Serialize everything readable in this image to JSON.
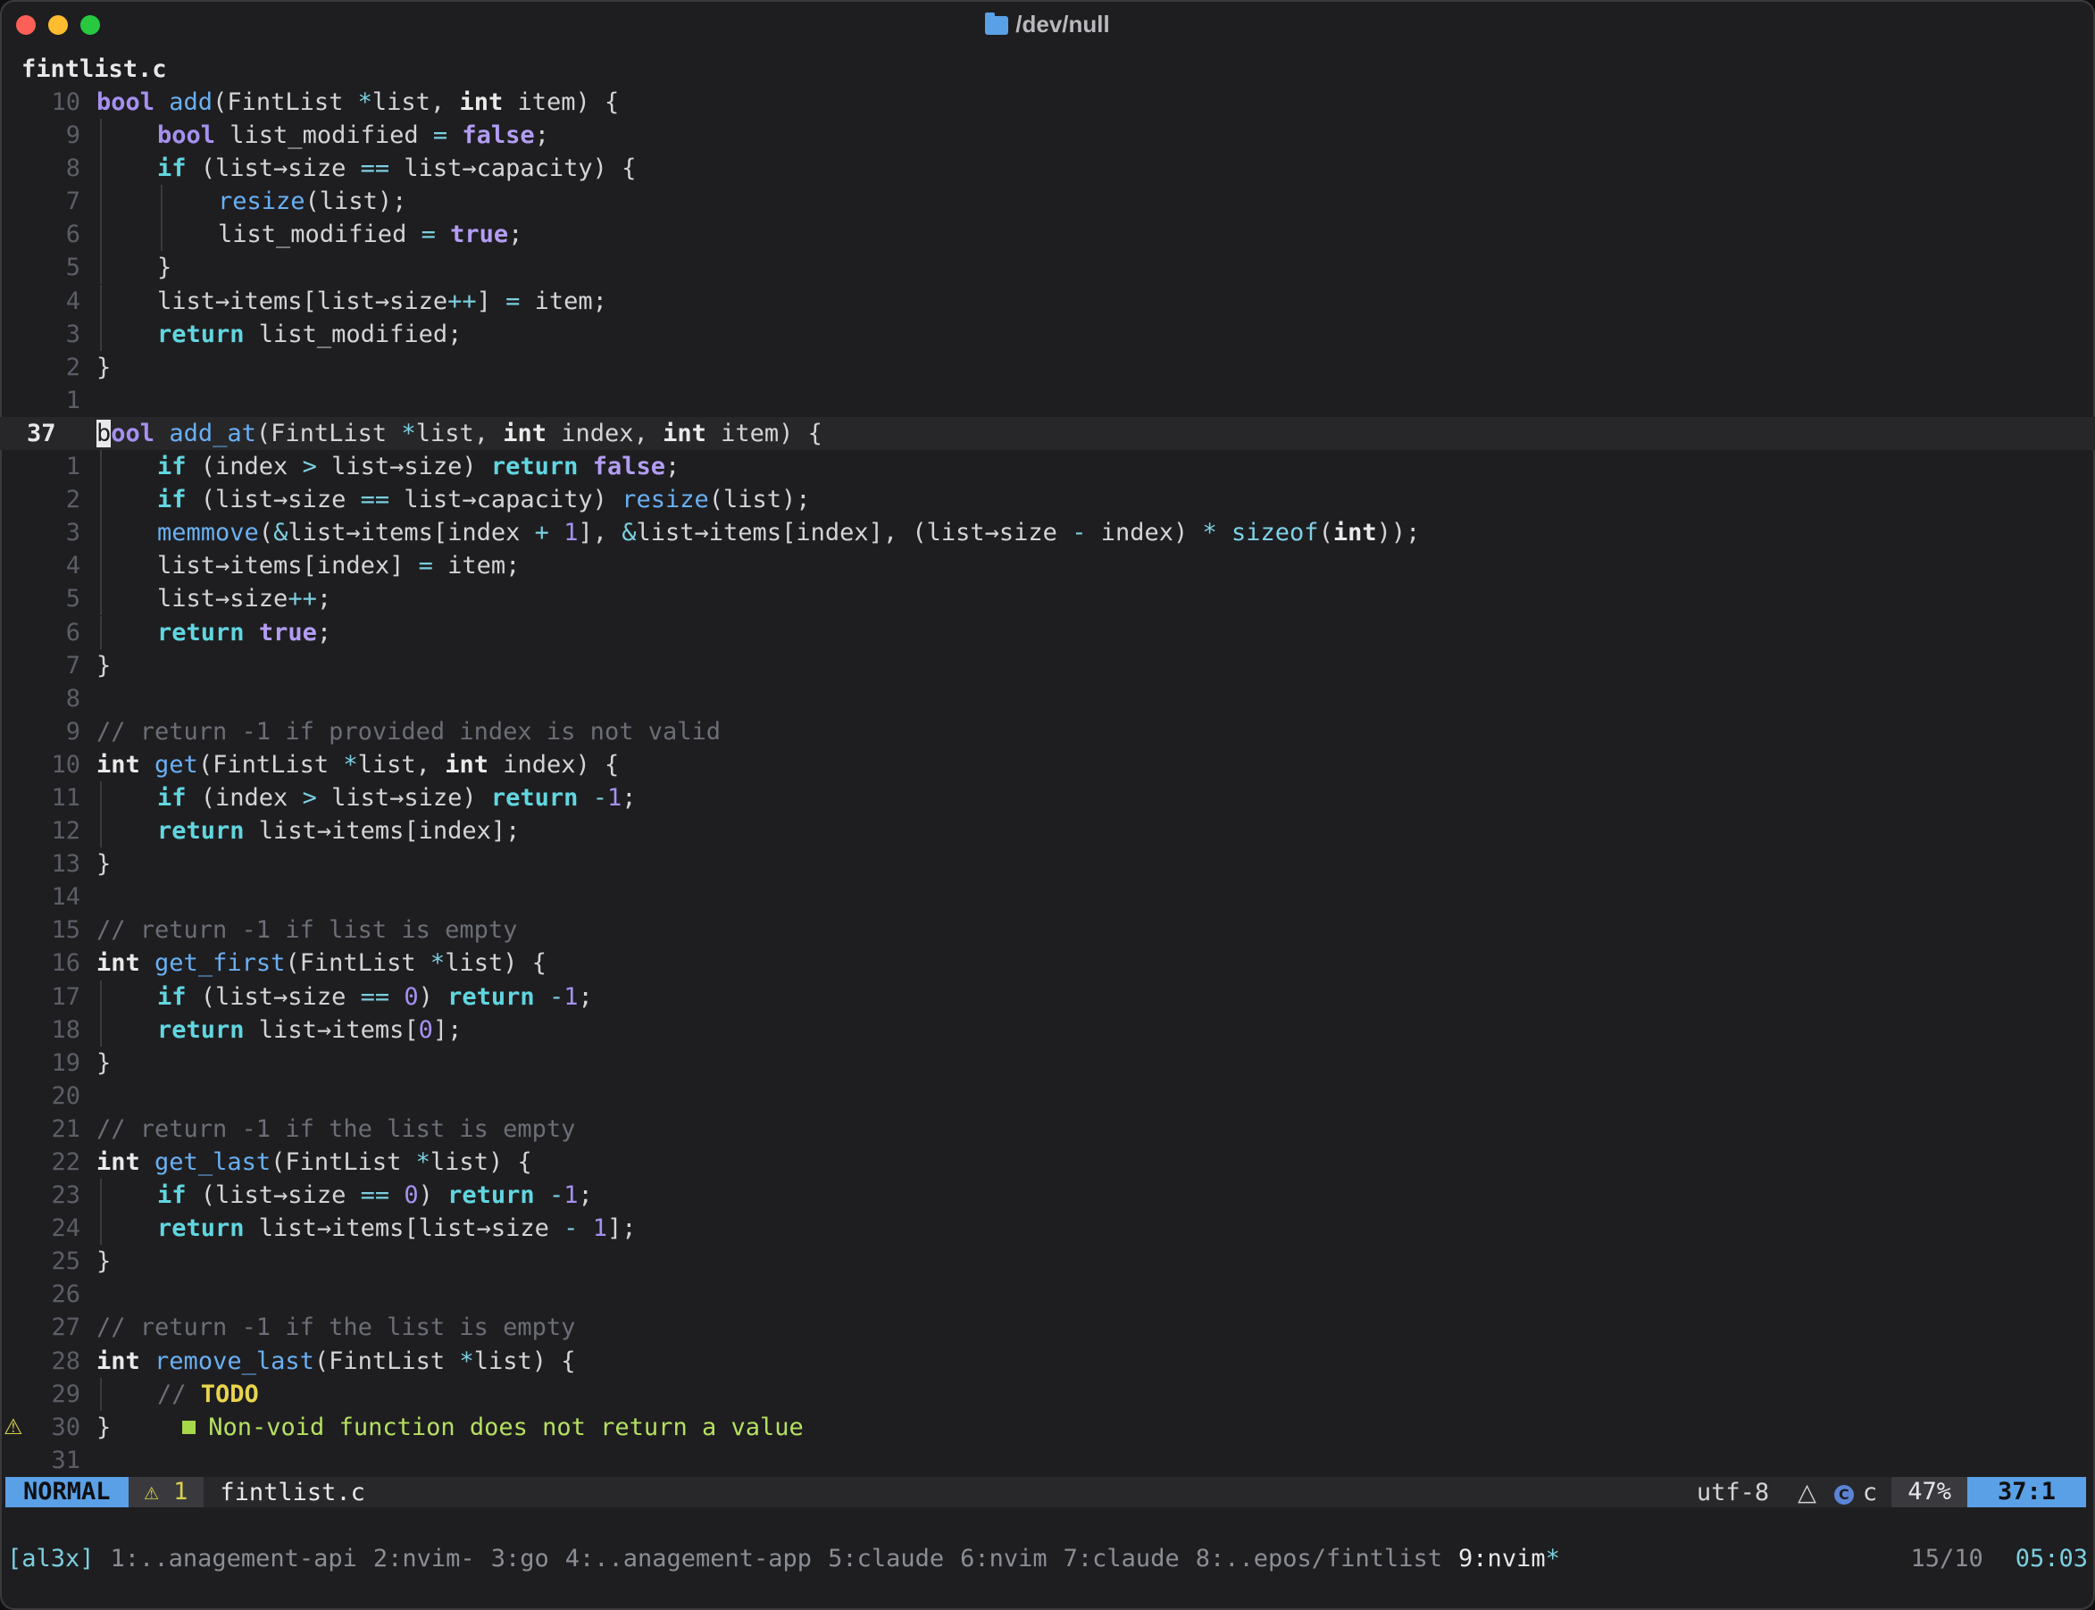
{
  "window": {
    "title": "/dev/null",
    "title_icon": "folder-icon",
    "traffic_lights": [
      "#fe5f57",
      "#febc2e",
      "#28c840"
    ]
  },
  "editor": {
    "filename": "fintlist.c",
    "cursor_line_index": 10,
    "lines": [
      {
        "n": "10",
        "tokens": [
          [
            "t-type",
            "bool"
          ],
          [
            "",
            " "
          ],
          [
            "t-fn",
            "add"
          ],
          [
            "",
            "(FintList "
          ],
          [
            "t-op",
            "*"
          ],
          [
            "",
            "list, "
          ],
          [
            "t-int",
            "int"
          ],
          [
            "",
            " item) {"
          ]
        ]
      },
      {
        "n": "9",
        "indent": 1,
        "tokens": [
          [
            "t-type",
            "bool"
          ],
          [
            "",
            " list_modified "
          ],
          [
            "t-op",
            "="
          ],
          [
            "",
            " "
          ],
          [
            "t-bool",
            "false"
          ],
          [
            "",
            ";"
          ]
        ]
      },
      {
        "n": "8",
        "indent": 1,
        "tokens": [
          [
            "t-kw",
            "if"
          ],
          [
            "",
            " (list→size "
          ],
          [
            "t-op",
            "=="
          ],
          [
            "",
            " list→capacity) {"
          ]
        ]
      },
      {
        "n": "7",
        "indent": 2,
        "tokens": [
          [
            "t-fn",
            "resize"
          ],
          [
            "",
            "(list);"
          ]
        ]
      },
      {
        "n": "6",
        "indent": 2,
        "tokens": [
          [
            "",
            "list_modified "
          ],
          [
            "t-op",
            "="
          ],
          [
            "",
            " "
          ],
          [
            "t-bool",
            "true"
          ],
          [
            "",
            ";"
          ]
        ]
      },
      {
        "n": "5",
        "indent": 1,
        "tokens": [
          [
            "",
            "}"
          ]
        ]
      },
      {
        "n": "4",
        "indent": 1,
        "tokens": [
          [
            "",
            "list→items[list→size"
          ],
          [
            "t-op",
            "++"
          ],
          [
            "",
            "] "
          ],
          [
            "t-op",
            "="
          ],
          [
            "",
            " item;"
          ]
        ]
      },
      {
        "n": "3",
        "indent": 1,
        "tokens": [
          [
            "t-kw",
            "return"
          ],
          [
            "",
            " list_modified;"
          ]
        ]
      },
      {
        "n": "2",
        "tokens": [
          [
            "",
            "}"
          ]
        ]
      },
      {
        "n": "1",
        "tokens": []
      },
      {
        "n": "37",
        "current": true,
        "tokens": [
          [
            "cursor",
            "b"
          ],
          [
            "t-type",
            "ool"
          ],
          [
            "",
            " "
          ],
          [
            "t-fn",
            "add_at"
          ],
          [
            "",
            "(FintList "
          ],
          [
            "t-op",
            "*"
          ],
          [
            "",
            "list, "
          ],
          [
            "t-int",
            "int"
          ],
          [
            "",
            " index, "
          ],
          [
            "t-int",
            "int"
          ],
          [
            "",
            " item) {"
          ]
        ]
      },
      {
        "n": "1",
        "indent": 1,
        "tokens": [
          [
            "t-kw",
            "if"
          ],
          [
            "",
            " (index "
          ],
          [
            "t-op",
            ">"
          ],
          [
            "",
            " list→size) "
          ],
          [
            "t-kw",
            "return"
          ],
          [
            "",
            " "
          ],
          [
            "t-bool",
            "false"
          ],
          [
            "",
            ";"
          ]
        ]
      },
      {
        "n": "2",
        "indent": 1,
        "tokens": [
          [
            "t-kw",
            "if"
          ],
          [
            "",
            " (list→size "
          ],
          [
            "t-op",
            "=="
          ],
          [
            "",
            " list→capacity) "
          ],
          [
            "t-fn",
            "resize"
          ],
          [
            "",
            "(list);"
          ]
        ]
      },
      {
        "n": "3",
        "indent": 1,
        "tokens": [
          [
            "t-fn",
            "memmove"
          ],
          [
            "",
            "("
          ],
          [
            "t-op",
            "&"
          ],
          [
            "",
            "list→items[index "
          ],
          [
            "t-op",
            "+"
          ],
          [
            "",
            " "
          ],
          [
            "t-num",
            "1"
          ],
          [
            "",
            "], "
          ],
          [
            "t-op",
            "&"
          ],
          [
            "",
            "list→items[index], (list→size "
          ],
          [
            "t-op",
            "-"
          ],
          [
            "",
            " index) "
          ],
          [
            "t-op",
            "*"
          ],
          [
            "",
            " "
          ],
          [
            "t-fnc",
            "sizeof"
          ],
          [
            "",
            "("
          ],
          [
            "t-int",
            "int"
          ],
          [
            "",
            "));"
          ]
        ]
      },
      {
        "n": "4",
        "indent": 1,
        "tokens": [
          [
            "",
            "list→items[index] "
          ],
          [
            "t-op",
            "="
          ],
          [
            "",
            " item;"
          ]
        ]
      },
      {
        "n": "5",
        "indent": 1,
        "tokens": [
          [
            "",
            "list→size"
          ],
          [
            "t-op",
            "++"
          ],
          [
            "",
            ";"
          ]
        ]
      },
      {
        "n": "6",
        "indent": 1,
        "tokens": [
          [
            "t-kw",
            "return"
          ],
          [
            "",
            " "
          ],
          [
            "t-bool",
            "true"
          ],
          [
            "",
            ";"
          ]
        ]
      },
      {
        "n": "7",
        "tokens": [
          [
            "",
            "}"
          ]
        ]
      },
      {
        "n": "8",
        "tokens": []
      },
      {
        "n": "9",
        "tokens": [
          [
            "t-com",
            "// return -1 if provided index is not valid"
          ]
        ]
      },
      {
        "n": "10",
        "tokens": [
          [
            "t-int",
            "int"
          ],
          [
            "",
            " "
          ],
          [
            "t-fn",
            "get"
          ],
          [
            "",
            "(FintList "
          ],
          [
            "t-op",
            "*"
          ],
          [
            "",
            "list, "
          ],
          [
            "t-int",
            "int"
          ],
          [
            "",
            " index) {"
          ]
        ]
      },
      {
        "n": "11",
        "indent": 1,
        "tokens": [
          [
            "t-kw",
            "if"
          ],
          [
            "",
            " (index "
          ],
          [
            "t-op",
            ">"
          ],
          [
            "",
            " list→size) "
          ],
          [
            "t-kw",
            "return"
          ],
          [
            "",
            " "
          ],
          [
            "t-op",
            "-"
          ],
          [
            "t-num",
            "1"
          ],
          [
            "",
            ";"
          ]
        ]
      },
      {
        "n": "12",
        "indent": 1,
        "tokens": [
          [
            "t-kw",
            "return"
          ],
          [
            "",
            " list→items[index];"
          ]
        ]
      },
      {
        "n": "13",
        "tokens": [
          [
            "",
            "}"
          ]
        ]
      },
      {
        "n": "14",
        "tokens": []
      },
      {
        "n": "15",
        "tokens": [
          [
            "t-com",
            "// return -1 if list is empty"
          ]
        ]
      },
      {
        "n": "16",
        "tokens": [
          [
            "t-int",
            "int"
          ],
          [
            "",
            " "
          ],
          [
            "t-fn",
            "get_first"
          ],
          [
            "",
            "(FintList "
          ],
          [
            "t-op",
            "*"
          ],
          [
            "",
            "list) {"
          ]
        ]
      },
      {
        "n": "17",
        "indent": 1,
        "tokens": [
          [
            "t-kw",
            "if"
          ],
          [
            "",
            " (list→size "
          ],
          [
            "t-op",
            "=="
          ],
          [
            "",
            " "
          ],
          [
            "t-num",
            "0"
          ],
          [
            "",
            ") "
          ],
          [
            "t-kw",
            "return"
          ],
          [
            "",
            " "
          ],
          [
            "t-op",
            "-"
          ],
          [
            "t-num",
            "1"
          ],
          [
            "",
            ";"
          ]
        ]
      },
      {
        "n": "18",
        "indent": 1,
        "tokens": [
          [
            "t-kw",
            "return"
          ],
          [
            "",
            " list→items["
          ],
          [
            "t-num",
            "0"
          ],
          [
            "",
            "];"
          ]
        ]
      },
      {
        "n": "19",
        "tokens": [
          [
            "",
            "}"
          ]
        ]
      },
      {
        "n": "20",
        "tokens": []
      },
      {
        "n": "21",
        "tokens": [
          [
            "t-com",
            "// return -1 if the list is empty"
          ]
        ]
      },
      {
        "n": "22",
        "tokens": [
          [
            "t-int",
            "int"
          ],
          [
            "",
            " "
          ],
          [
            "t-fn",
            "get_last"
          ],
          [
            "",
            "(FintList "
          ],
          [
            "t-op",
            "*"
          ],
          [
            "",
            "list) {"
          ]
        ]
      },
      {
        "n": "23",
        "indent": 1,
        "tokens": [
          [
            "t-kw",
            "if"
          ],
          [
            "",
            " (list→size "
          ],
          [
            "t-op",
            "=="
          ],
          [
            "",
            " "
          ],
          [
            "t-num",
            "0"
          ],
          [
            "",
            ") "
          ],
          [
            "t-kw",
            "return"
          ],
          [
            "",
            " "
          ],
          [
            "t-op",
            "-"
          ],
          [
            "t-num",
            "1"
          ],
          [
            "",
            ";"
          ]
        ]
      },
      {
        "n": "24",
        "indent": 1,
        "tokens": [
          [
            "t-kw",
            "return"
          ],
          [
            "",
            " list→items[list→size "
          ],
          [
            "t-op",
            "-"
          ],
          [
            "",
            " "
          ],
          [
            "t-num",
            "1"
          ],
          [
            "",
            "];"
          ]
        ]
      },
      {
        "n": "25",
        "tokens": [
          [
            "",
            "}"
          ]
        ]
      },
      {
        "n": "26",
        "tokens": []
      },
      {
        "n": "27",
        "tokens": [
          [
            "t-com",
            "// return -1 if the list is empty"
          ]
        ]
      },
      {
        "n": "28",
        "tokens": [
          [
            "t-int",
            "int"
          ],
          [
            "",
            " "
          ],
          [
            "t-fn",
            "remove_last"
          ],
          [
            "",
            "(FintList "
          ],
          [
            "t-op",
            "*"
          ],
          [
            "",
            "list) {"
          ]
        ]
      },
      {
        "n": "29",
        "indent": 1,
        "tokens": [
          [
            "t-com",
            "// "
          ],
          [
            "t-todo",
            "TODO"
          ]
        ]
      },
      {
        "n": "30",
        "sign": "⚠",
        "tokens": [
          [
            "",
            "}"
          ]
        ],
        "diagnostic": "Non-void function does not return a value"
      },
      {
        "n": "31",
        "tokens": []
      }
    ]
  },
  "statusline": {
    "mode": "NORMAL",
    "warning_icon": "warning-icon",
    "warnings": "1",
    "file": "fintlist.c",
    "encoding": "utf-8",
    "os_icon": "linux-icon",
    "filetype": "c",
    "filetype_icon": "c-lang-icon",
    "percent": "47%",
    "position": "37:1"
  },
  "tmux": {
    "session": "[al3x]",
    "windows": [
      {
        "label": "1:..anagement-api"
      },
      {
        "label": "2:nvim-"
      },
      {
        "label": "3:go"
      },
      {
        "label": "4:..anagement-app"
      },
      {
        "label": "5:claude"
      },
      {
        "label": "6:nvim"
      },
      {
        "label": "7:claude"
      },
      {
        "label": "8:..epos/fintlist"
      },
      {
        "label": "9:nvim",
        "active": true,
        "flag": "*"
      }
    ],
    "ratio": "15/10",
    "time": "05:03"
  }
}
